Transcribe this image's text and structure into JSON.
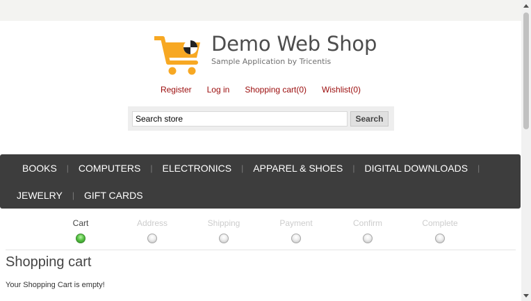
{
  "header": {
    "title": "Demo Web Shop",
    "subtitle": "Sample Application by Tricentis",
    "links": [
      "Register",
      "Log in",
      "Shopping cart(0)",
      "Wishlist(0)"
    ]
  },
  "search": {
    "placeholder": "Search store",
    "button_label": "Search"
  },
  "menu": {
    "row1": [
      "BOOKS",
      "COMPUTERS",
      "ELECTRONICS",
      "APPAREL & SHOES",
      "DIGITAL DOWNLOADS"
    ],
    "row2": [
      "JEWELRY",
      "GIFT CARDS"
    ],
    "separator": "|"
  },
  "checkout_steps": {
    "active": "Cart",
    "steps": [
      "Cart",
      "Address",
      "Shipping",
      "Payment",
      "Confirm",
      "Complete"
    ]
  },
  "main": {
    "page_title": "Shopping cart",
    "empty_message": "Your Shopping Cart is empty!"
  },
  "colors": {
    "link": "#9a0a0a",
    "menu_bg": "#3d3d3d",
    "logo_cart": "#f7a823",
    "active_step": "#59c446"
  }
}
